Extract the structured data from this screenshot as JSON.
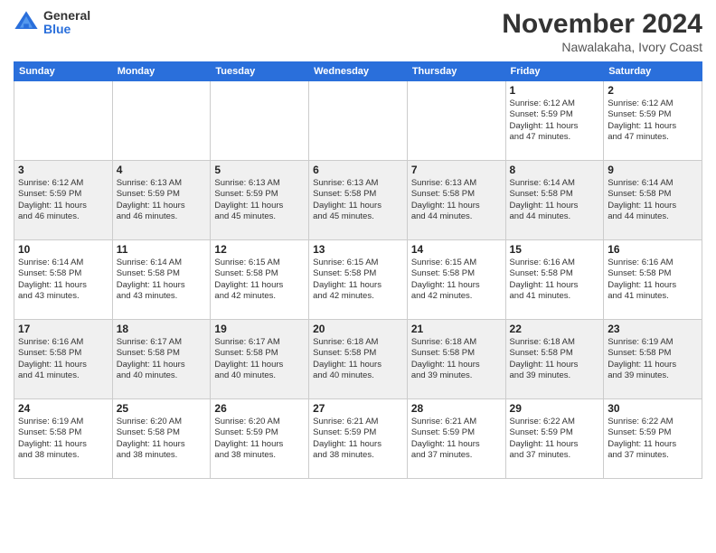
{
  "logo": {
    "general": "General",
    "blue": "Blue"
  },
  "title": "November 2024",
  "location": "Nawalakaha, Ivory Coast",
  "days_header": [
    "Sunday",
    "Monday",
    "Tuesday",
    "Wednesday",
    "Thursday",
    "Friday",
    "Saturday"
  ],
  "weeks": [
    [
      {
        "day": "",
        "content": ""
      },
      {
        "day": "",
        "content": ""
      },
      {
        "day": "",
        "content": ""
      },
      {
        "day": "",
        "content": ""
      },
      {
        "day": "",
        "content": ""
      },
      {
        "day": "1",
        "content": "Sunrise: 6:12 AM\nSunset: 5:59 PM\nDaylight: 11 hours\nand 47 minutes."
      },
      {
        "day": "2",
        "content": "Sunrise: 6:12 AM\nSunset: 5:59 PM\nDaylight: 11 hours\nand 47 minutes."
      }
    ],
    [
      {
        "day": "3",
        "content": "Sunrise: 6:12 AM\nSunset: 5:59 PM\nDaylight: 11 hours\nand 46 minutes."
      },
      {
        "day": "4",
        "content": "Sunrise: 6:13 AM\nSunset: 5:59 PM\nDaylight: 11 hours\nand 46 minutes."
      },
      {
        "day": "5",
        "content": "Sunrise: 6:13 AM\nSunset: 5:59 PM\nDaylight: 11 hours\nand 45 minutes."
      },
      {
        "day": "6",
        "content": "Sunrise: 6:13 AM\nSunset: 5:58 PM\nDaylight: 11 hours\nand 45 minutes."
      },
      {
        "day": "7",
        "content": "Sunrise: 6:13 AM\nSunset: 5:58 PM\nDaylight: 11 hours\nand 44 minutes."
      },
      {
        "day": "8",
        "content": "Sunrise: 6:14 AM\nSunset: 5:58 PM\nDaylight: 11 hours\nand 44 minutes."
      },
      {
        "day": "9",
        "content": "Sunrise: 6:14 AM\nSunset: 5:58 PM\nDaylight: 11 hours\nand 44 minutes."
      }
    ],
    [
      {
        "day": "10",
        "content": "Sunrise: 6:14 AM\nSunset: 5:58 PM\nDaylight: 11 hours\nand 43 minutes."
      },
      {
        "day": "11",
        "content": "Sunrise: 6:14 AM\nSunset: 5:58 PM\nDaylight: 11 hours\nand 43 minutes."
      },
      {
        "day": "12",
        "content": "Sunrise: 6:15 AM\nSunset: 5:58 PM\nDaylight: 11 hours\nand 42 minutes."
      },
      {
        "day": "13",
        "content": "Sunrise: 6:15 AM\nSunset: 5:58 PM\nDaylight: 11 hours\nand 42 minutes."
      },
      {
        "day": "14",
        "content": "Sunrise: 6:15 AM\nSunset: 5:58 PM\nDaylight: 11 hours\nand 42 minutes."
      },
      {
        "day": "15",
        "content": "Sunrise: 6:16 AM\nSunset: 5:58 PM\nDaylight: 11 hours\nand 41 minutes."
      },
      {
        "day": "16",
        "content": "Sunrise: 6:16 AM\nSunset: 5:58 PM\nDaylight: 11 hours\nand 41 minutes."
      }
    ],
    [
      {
        "day": "17",
        "content": "Sunrise: 6:16 AM\nSunset: 5:58 PM\nDaylight: 11 hours\nand 41 minutes."
      },
      {
        "day": "18",
        "content": "Sunrise: 6:17 AM\nSunset: 5:58 PM\nDaylight: 11 hours\nand 40 minutes."
      },
      {
        "day": "19",
        "content": "Sunrise: 6:17 AM\nSunset: 5:58 PM\nDaylight: 11 hours\nand 40 minutes."
      },
      {
        "day": "20",
        "content": "Sunrise: 6:18 AM\nSunset: 5:58 PM\nDaylight: 11 hours\nand 40 minutes."
      },
      {
        "day": "21",
        "content": "Sunrise: 6:18 AM\nSunset: 5:58 PM\nDaylight: 11 hours\nand 39 minutes."
      },
      {
        "day": "22",
        "content": "Sunrise: 6:18 AM\nSunset: 5:58 PM\nDaylight: 11 hours\nand 39 minutes."
      },
      {
        "day": "23",
        "content": "Sunrise: 6:19 AM\nSunset: 5:58 PM\nDaylight: 11 hours\nand 39 minutes."
      }
    ],
    [
      {
        "day": "24",
        "content": "Sunrise: 6:19 AM\nSunset: 5:58 PM\nDaylight: 11 hours\nand 38 minutes."
      },
      {
        "day": "25",
        "content": "Sunrise: 6:20 AM\nSunset: 5:58 PM\nDaylight: 11 hours\nand 38 minutes."
      },
      {
        "day": "26",
        "content": "Sunrise: 6:20 AM\nSunset: 5:59 PM\nDaylight: 11 hours\nand 38 minutes."
      },
      {
        "day": "27",
        "content": "Sunrise: 6:21 AM\nSunset: 5:59 PM\nDaylight: 11 hours\nand 38 minutes."
      },
      {
        "day": "28",
        "content": "Sunrise: 6:21 AM\nSunset: 5:59 PM\nDaylight: 11 hours\nand 37 minutes."
      },
      {
        "day": "29",
        "content": "Sunrise: 6:22 AM\nSunset: 5:59 PM\nDaylight: 11 hours\nand 37 minutes."
      },
      {
        "day": "30",
        "content": "Sunrise: 6:22 AM\nSunset: 5:59 PM\nDaylight: 11 hours\nand 37 minutes."
      }
    ]
  ]
}
